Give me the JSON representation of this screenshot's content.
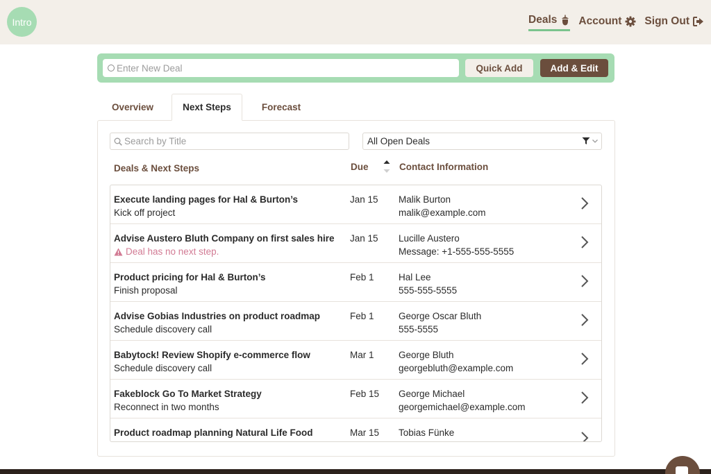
{
  "header": {
    "logo": "Intro",
    "nav": [
      {
        "label": "Deals",
        "icon": "acorn-icon",
        "active": true
      },
      {
        "label": "Account",
        "icon": "gear-icon"
      },
      {
        "label": "Sign Out",
        "icon": "sign-out-icon"
      }
    ]
  },
  "add_bar": {
    "placeholder": "Enter New Deal",
    "quick_add_label": "Quick Add",
    "add_edit_label": "Add & Edit"
  },
  "tabs": [
    {
      "label": "Overview"
    },
    {
      "label": "Next Steps",
      "active": true
    },
    {
      "label": "Forecast"
    }
  ],
  "filters": {
    "search_placeholder": "Search by Title",
    "selected": "All Open Deals"
  },
  "columns": {
    "deals": "Deals & Next Steps",
    "due": "Due",
    "contact": "Contact Information"
  },
  "rows": [
    {
      "title": "Execute landing pages for Hal & Burton’s",
      "next_step": "Kick off project",
      "due": "Jan 15",
      "contact_name": "Malik Burton",
      "contact_info": "malik@example.com"
    },
    {
      "title": "Advise Austero Bluth Company on first sales hire",
      "next_step": "Deal has no next step.",
      "warning": true,
      "due": "Jan 15",
      "contact_name": "Lucille Austero",
      "contact_info": "Message: +1-555-555-5555"
    },
    {
      "title": "Product pricing for Hal & Burton’s",
      "next_step": "Finish proposal",
      "due": "Feb 1",
      "contact_name": "Hal Lee",
      "contact_info": "555-555-5555"
    },
    {
      "title": "Advise Gobias Industries on product roadmap",
      "next_step": "Schedule discovery call",
      "due": "Feb 1",
      "contact_name": "George Oscar Bluth",
      "contact_info": "555-5555"
    },
    {
      "title": "Babytock! Review Shopify e-commerce flow",
      "next_step": "Schedule discovery call",
      "due": "Mar 1",
      "contact_name": "George Bluth",
      "contact_info": "georgebluth@example.com"
    },
    {
      "title": "Fakeblock Go To Market Strategy",
      "next_step": "Reconnect in two months",
      "due": "Feb 15",
      "contact_name": "George Michael",
      "contact_info": "georgemichael@example.com"
    },
    {
      "title": "Product roadmap planning Natural Life Food",
      "next_step": "",
      "due": "Mar 15",
      "contact_name": "Tobias Fünke",
      "contact_info": ""
    }
  ],
  "colors": {
    "brand_brown": "#6b4e3d",
    "brand_green": "#a6dcb3",
    "header_bg": "#f3efe9",
    "warning": "#d27b94"
  }
}
